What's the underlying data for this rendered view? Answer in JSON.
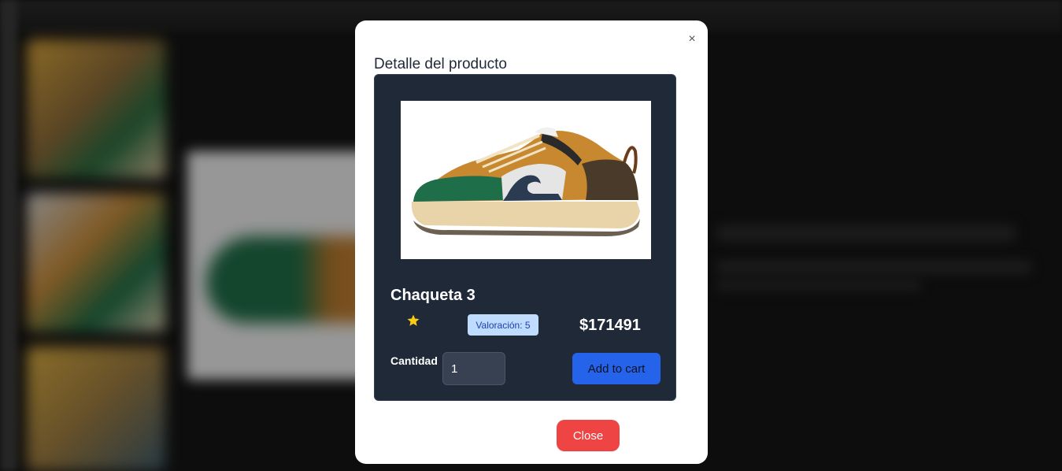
{
  "modal": {
    "title": "Detalle del producto",
    "close_icon": "×",
    "close_button_label": "Close"
  },
  "product": {
    "name": "Chaqueta 3",
    "rating_badge": "Valoración: 5",
    "price": "$171491",
    "quantity_label": "Cantidad",
    "quantity_value": "1",
    "add_to_cart_label": "Add to cart",
    "image_icon": "sneaker-image",
    "star_icon": "star-icon"
  },
  "colors": {
    "card_bg": "#1f2937",
    "badge_bg": "#bfdbfe",
    "add_to_cart": "#2563eb",
    "close": "#ef4444",
    "star": "#facc15"
  }
}
